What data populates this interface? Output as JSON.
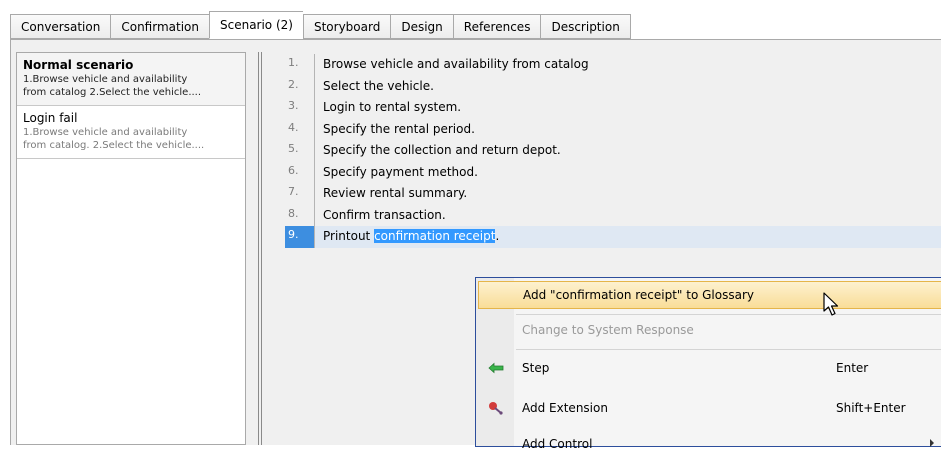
{
  "tabs": [
    {
      "label": "Conversation"
    },
    {
      "label": "Confirmation"
    },
    {
      "label": "Scenario (2)"
    },
    {
      "label": "Storyboard"
    },
    {
      "label": "Design"
    },
    {
      "label": "References"
    },
    {
      "label": "Description"
    }
  ],
  "active_tab": "Scenario (2)",
  "scenarios": [
    {
      "title": "Normal scenario",
      "desc_line1": "1.Browse vehicle and availability",
      "desc_line2": "from catalog 2.Select the vehicle...."
    },
    {
      "title": "Login fail",
      "desc_line1": "1.Browse vehicle and availability",
      "desc_line2": "from catalog. 2.Select the vehicle...."
    }
  ],
  "steps": [
    {
      "num": "1.",
      "text": "Browse vehicle and availability from catalog"
    },
    {
      "num": "2.",
      "text": "Select the vehicle."
    },
    {
      "num": "3.",
      "text": "Login to rental system."
    },
    {
      "num": "4.",
      "text": "Specify the rental period."
    },
    {
      "num": "5.",
      "text": "Specify the collection and return depot."
    },
    {
      "num": "6.",
      "text": "Specify payment method."
    },
    {
      "num": "7.",
      "text": "Review rental summary."
    },
    {
      "num": "8.",
      "text": "Confirm transaction."
    },
    {
      "num": "9.",
      "text_before": "Printout ",
      "text_selected": "confirmation receipt",
      "text_after": "."
    }
  ],
  "context_menu": {
    "add_glossary": "Add \"confirmation receipt\" to Glossary",
    "change_system_response": "Change to System Response",
    "step": {
      "label": "Step",
      "shortcut": "Enter"
    },
    "add_extension": {
      "label": "Add Extension",
      "shortcut": "Shift+Enter"
    },
    "add_control": {
      "label": "Add Control"
    }
  },
  "icons": {
    "step": "green-left-arrow-icon",
    "add_extension": "red-extension-icon",
    "add_control": "submenu-arrow-icon"
  },
  "colors": {
    "selection": "#3399ff",
    "menu_border": "#2d4e9c",
    "menu_hover": "#f9dd98"
  }
}
